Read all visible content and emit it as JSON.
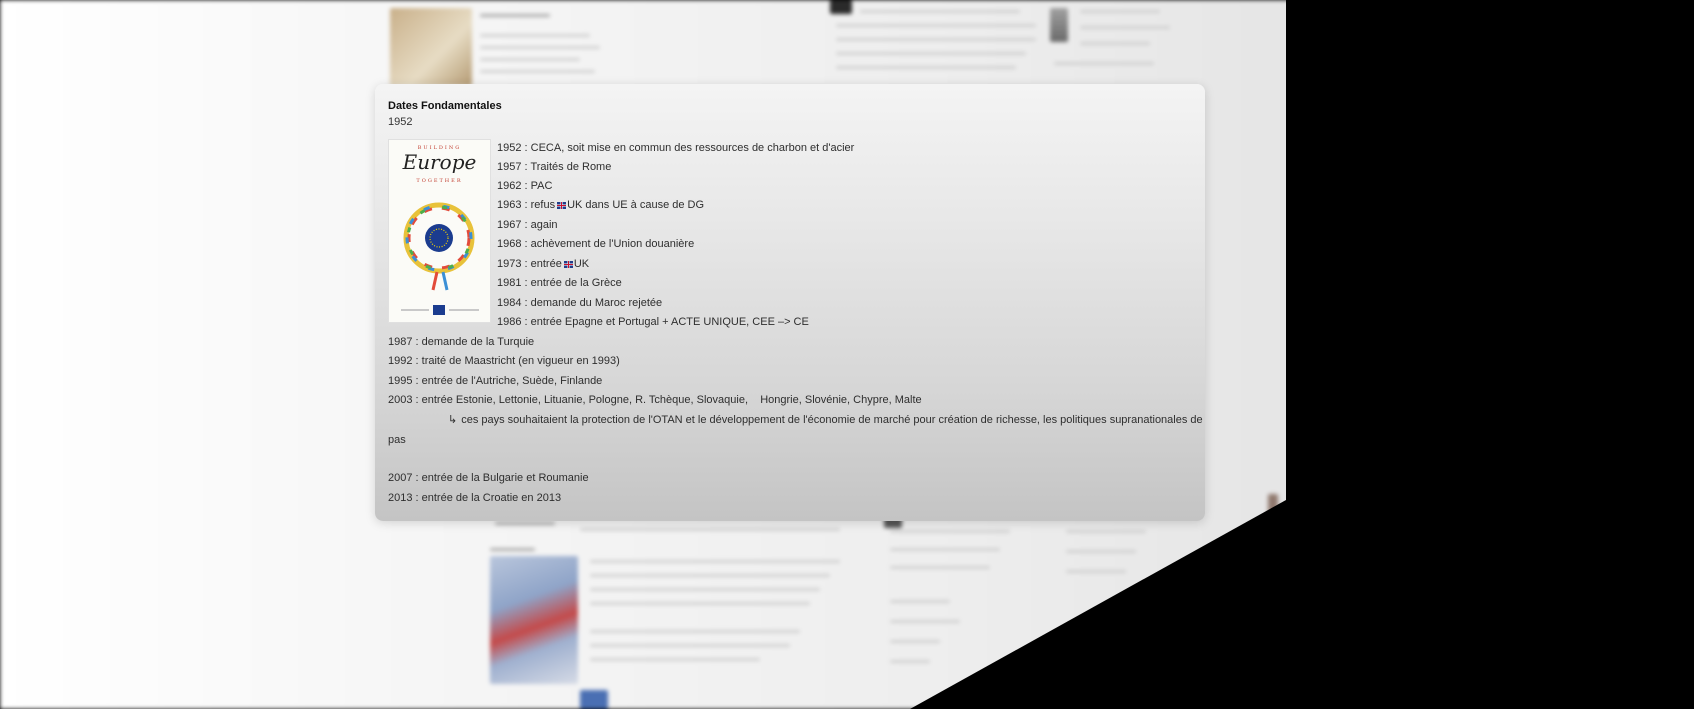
{
  "popup": {
    "title": "Dates Fondamentales",
    "subtitle": "1952",
    "image": {
      "alt": "Building Europe Together poster",
      "top_text": "BUILDING",
      "main_text": "Europe",
      "bottom_text": "TOGETHER"
    },
    "entries": [
      {
        "text": "1952 : CECA, soit mise en commun des ressources de charbon et d'acier"
      },
      {
        "text": "1957 : Traités de Rome"
      },
      {
        "text": "1962 : PAC"
      },
      {
        "prefix": "1963 : refus ",
        "flag": "uk-flag-icon",
        "suffix": "UK dans UE à cause de DG"
      },
      {
        "text": "1967 : again"
      },
      {
        "text": "1968 : achèvement de l'Union douanière"
      },
      {
        "prefix": "1973 : entrée ",
        "flag": "uk-flag-icon",
        "suffix": "UK"
      },
      {
        "text": "1981 : entrée de la Grèce"
      },
      {
        "text": "1984 : demande du Maroc rejetée"
      },
      {
        "text": "1986 : entrée Epagne et Portugal + ACTE UNIQUE, CEE –> CE"
      },
      {
        "text": "1987 : demande de la Turquie"
      },
      {
        "text": "1992 : traité de Maastricht (en vigueur en 1993)"
      },
      {
        "text": "1995 : entrée de l'Autriche, Suède, Finlande"
      },
      {
        "text": "2003 : entrée Estonie, Lettonie, Lituanie, Pologne, R. Tchèque, Slovaquie,    Hongrie, Slovénie, Chypre, Malte"
      },
      {
        "arrow": "↳",
        "text": "ces pays souhaitaient la protection de l'OTAN et le développement de l'économie de marché pour création de richesse, les politiques supranationales de l'Europe ne les"
      },
      {
        "text": "pas"
      },
      {
        "text": "2007 : entrée de la Bulgarie et Roumanie"
      },
      {
        "text": "2013 : entrée de la Croatie en 2013"
      }
    ]
  },
  "colors": {
    "popup_background_top": "#f4f4f4",
    "popup_background_bottom": "#c4c4c4",
    "text": "#2e2e2e",
    "backdrop": "#000000"
  }
}
